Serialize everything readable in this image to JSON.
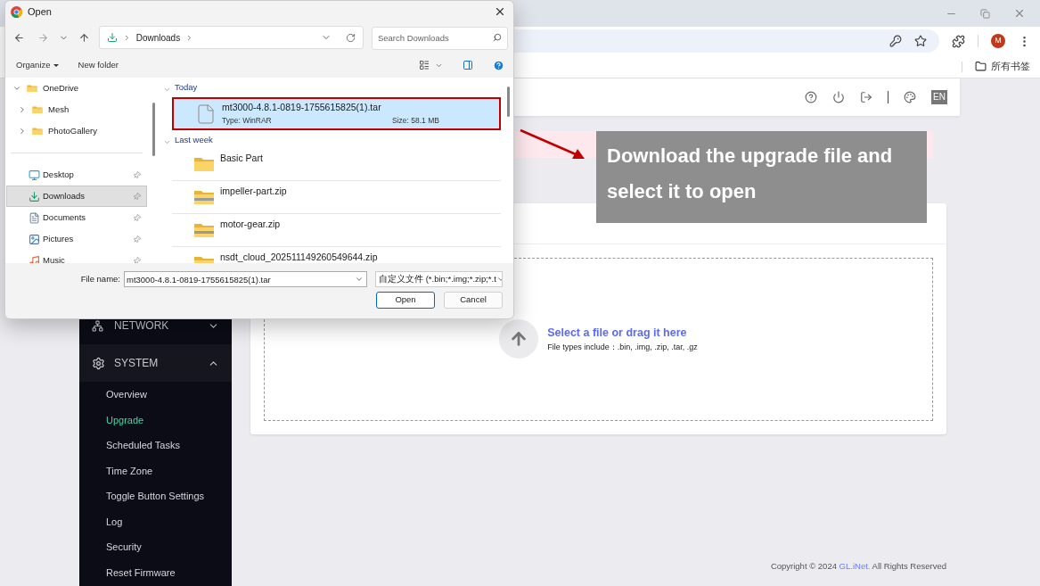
{
  "browser": {
    "bookmarks": {
      "label": "所有书签"
    },
    "profile": {
      "initial": "M"
    }
  },
  "router": {
    "header": {
      "language": "EN"
    },
    "sidebar": [
      {
        "label": "NETWORK",
        "expanded": false
      },
      {
        "label": "SYSTEM",
        "expanded": true,
        "children": [
          {
            "label": "Overview",
            "selected": false
          },
          {
            "label": "Upgrade",
            "selected": true
          },
          {
            "label": "Scheduled Tasks",
            "selected": false
          },
          {
            "label": "Time Zone",
            "selected": false
          },
          {
            "label": "Toggle Button Settings",
            "selected": false
          },
          {
            "label": "Log",
            "selected": false
          },
          {
            "label": "Security",
            "selected": false
          },
          {
            "label": "Reset Firmware",
            "selected": false
          }
        ]
      }
    ],
    "upload": {
      "title": "Select a file or drag it here",
      "hint": "File types include：.bin, .img, .zip, .tar, .gz"
    },
    "footer": {
      "prefix": "Copyright © 2024",
      "link": "GL.iNet.",
      "suffix": "All Rights Reserved"
    }
  },
  "annotation": {
    "text": "Download the upgrade file and select it to open"
  },
  "dialog": {
    "title": "Open",
    "path": "Downloads",
    "search": {
      "placeholder": "Search Downloads"
    },
    "commands": [
      "Organize",
      "New folder"
    ],
    "tree": [
      {
        "label": "OneDrive",
        "expanded": true,
        "children": [
          {
            "label": "Mesh",
            "expanded": false
          },
          {
            "label": "PhotoGallery",
            "expanded": false
          }
        ]
      }
    ],
    "places": [
      {
        "kind": "desktop",
        "label": "Desktop",
        "selected": false
      },
      {
        "kind": "downloads",
        "label": "Downloads",
        "selected": true
      },
      {
        "kind": "documents",
        "label": "Documents",
        "selected": false
      },
      {
        "kind": "pictures",
        "label": "Pictures",
        "selected": false
      },
      {
        "kind": "music",
        "label": "Music",
        "selected": false
      }
    ],
    "groups": [
      {
        "label": "Today",
        "expanded": true,
        "files": [
          {
            "kind": "file",
            "name": "mt3000-4.8.1-0819-1755615825(1).tar",
            "type": "Type: WinRAR",
            "size": "Size: 58.1 MB",
            "selected": true,
            "highlighted": true
          }
        ]
      },
      {
        "label": "Last week",
        "expanded": true,
        "files": [
          {
            "kind": "folder",
            "name": "Basic Part",
            "selected": false,
            "highlighted": false
          },
          {
            "kind": "zip",
            "name": "impeller-part.zip",
            "selected": false,
            "highlighted": false
          },
          {
            "kind": "zip",
            "name": "motor-gear.zip",
            "selected": false,
            "highlighted": false
          },
          {
            "kind": "zip",
            "name": "nsdt_cloud_202511149260549644.zip",
            "selected": false,
            "highlighted": false
          }
        ]
      }
    ],
    "file_name_label": "File name:",
    "file_name": "mt3000-4.8.1-0819-1755615825(1).tar",
    "file_type": "自定义文件 (*.bin;*.img;*.zip;*.t",
    "buttons": [
      {
        "label": "Open",
        "default": true
      },
      {
        "label": "Cancel",
        "default": false
      }
    ]
  }
}
